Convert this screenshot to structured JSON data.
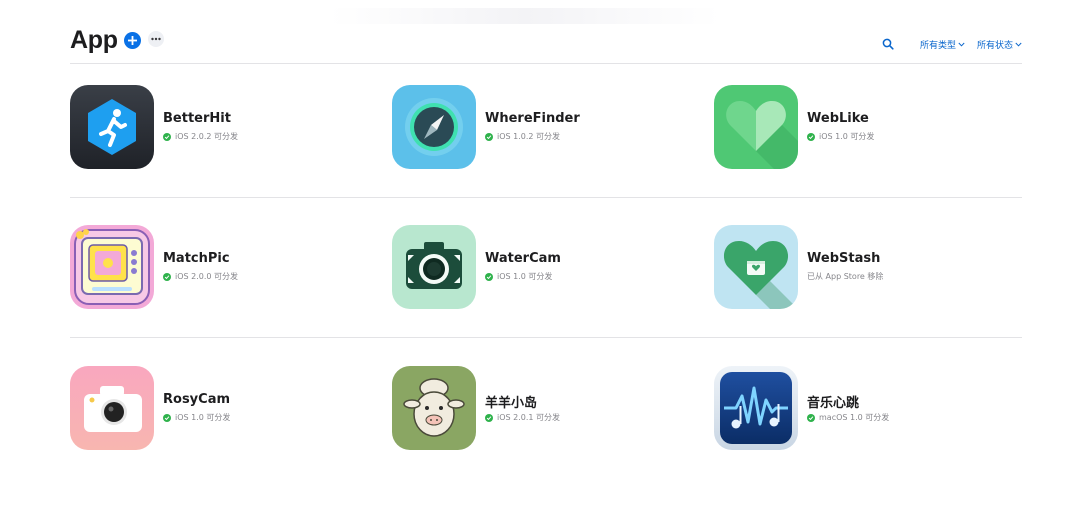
{
  "header": {
    "title": "App",
    "filter_type": "所有类型",
    "filter_status": "所有状态"
  },
  "colors": {
    "accent": "#0a71e6",
    "status_green": "#2fb24c"
  },
  "apps": [
    {
      "name": "BetterHit",
      "status": "iOS 2.0.2 可分发",
      "ok": true,
      "icon": "running-figure-icon"
    },
    {
      "name": "WhereFinder",
      "status": "iOS 1.0.2 可分发",
      "ok": true,
      "icon": "compass-icon"
    },
    {
      "name": "WebLike",
      "status": "iOS 1.0 可分发",
      "ok": true,
      "icon": "heart-icon"
    },
    {
      "name": "MatchPic",
      "status": "iOS 2.0.0 可分发",
      "ok": true,
      "icon": "gameboy-icon"
    },
    {
      "name": "WaterCam",
      "status": "iOS 1.0 可分发",
      "ok": true,
      "icon": "camera-icon"
    },
    {
      "name": "WebStash",
      "status": "已从 App Store 移除",
      "ok": false,
      "icon": "heart-stash-icon"
    },
    {
      "name": "RosyCam",
      "status": "iOS 1.0 可分发",
      "ok": true,
      "icon": "pink-camera-icon"
    },
    {
      "name": "羊羊小岛",
      "status": "iOS 2.0.1 可分发",
      "ok": true,
      "icon": "sheep-icon"
    },
    {
      "name": "音乐心跳",
      "status": "macOS 1.0 可分发",
      "ok": true,
      "icon": "music-wave-icon"
    }
  ]
}
